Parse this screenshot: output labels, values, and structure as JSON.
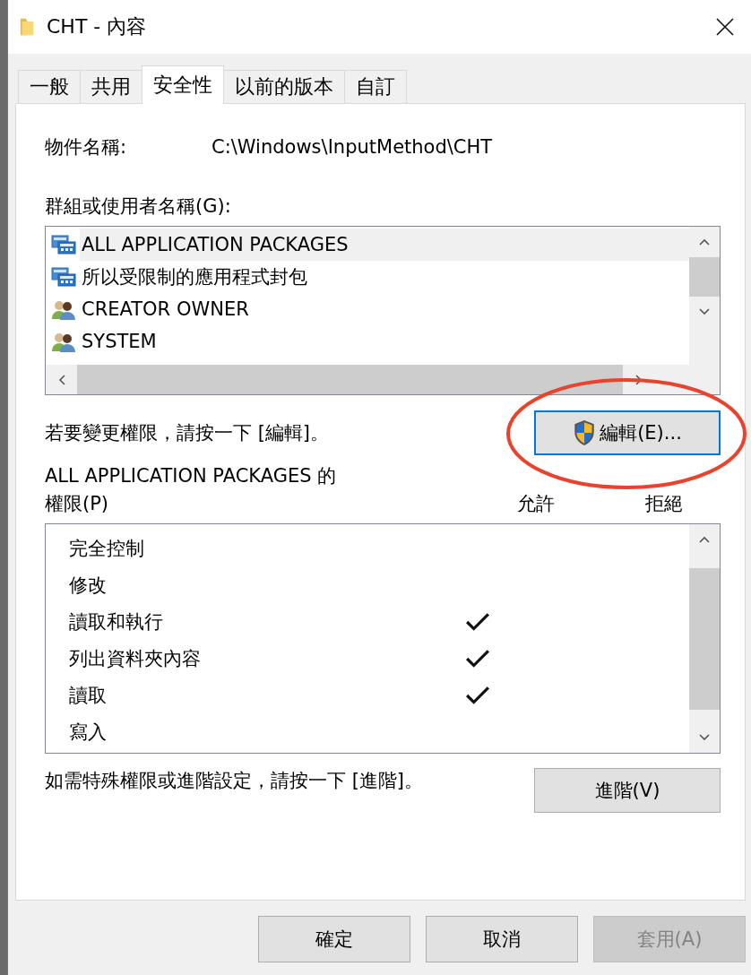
{
  "window": {
    "title": "CHT - 內容"
  },
  "tabs": [
    {
      "label": "一般",
      "selected": false
    },
    {
      "label": "共用",
      "selected": false
    },
    {
      "label": "安全性",
      "selected": true
    },
    {
      "label": "以前的版本",
      "selected": false
    },
    {
      "label": "自訂",
      "selected": false
    }
  ],
  "object_name": {
    "label": "物件名稱:",
    "value": "C:\\Windows\\InputMethod\\CHT"
  },
  "groups": {
    "label": "群組或使用者名稱(G):",
    "items": [
      {
        "name": "ALL APPLICATION PACKAGES",
        "kind": "package",
        "selected": true
      },
      {
        "name": "所以受限制的應用程式封包",
        "kind": "package",
        "selected": false
      },
      {
        "name": "CREATOR OWNER",
        "kind": "users",
        "selected": false
      },
      {
        "name": "SYSTEM",
        "kind": "users",
        "selected": false
      }
    ]
  },
  "edit_hint": "若要變更權限，請按一下 [編輯]。",
  "edit_button": {
    "label": "編輯(E)...",
    "focused": true
  },
  "permissions": {
    "title": "ALL APPLICATION PACKAGES 的",
    "label": "權限(P)",
    "allow_header": "允許",
    "deny_header": "拒絕",
    "rows": [
      {
        "name": "完全控制",
        "allow": false,
        "deny": false
      },
      {
        "name": "修改",
        "allow": false,
        "deny": false
      },
      {
        "name": "讀取和執行",
        "allow": true,
        "deny": false
      },
      {
        "name": "列出資料夾內容",
        "allow": true,
        "deny": false
      },
      {
        "name": "讀取",
        "allow": true,
        "deny": false
      },
      {
        "name": "寫入",
        "allow": false,
        "deny": false
      }
    ]
  },
  "advanced_hint": "如需特殊權限或進階設定，請按一下 [進階]。",
  "advanced_button": {
    "label": "進階(V)"
  },
  "buttons": [
    {
      "label": "確定",
      "disabled": false
    },
    {
      "label": "取消",
      "disabled": false
    },
    {
      "label": "套用(A)",
      "disabled": true
    }
  ]
}
